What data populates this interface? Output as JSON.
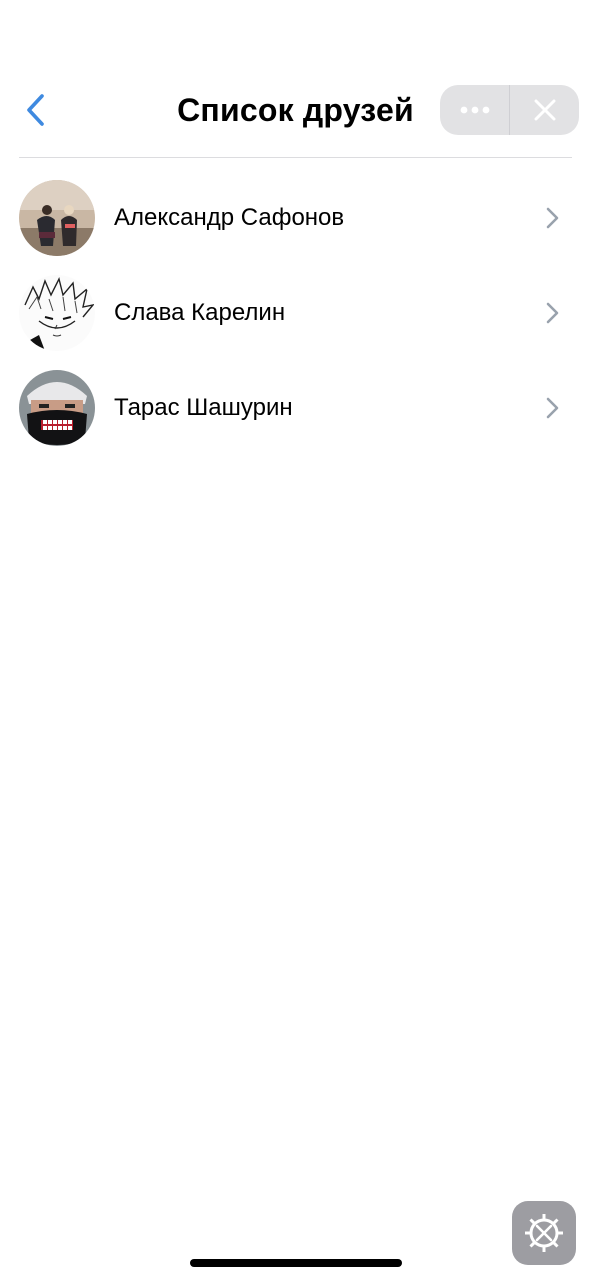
{
  "header": {
    "title": "Список друзей",
    "back_icon": "chevron-left-icon",
    "more_icon": "ellipsis-icon",
    "close_icon": "close-icon"
  },
  "friends": [
    {
      "name": "Александр Сафонов",
      "avatar": "photo-two-people"
    },
    {
      "name": "Слава Карелин",
      "avatar": "manga-character-sketch"
    },
    {
      "name": "Тарас Шашурин",
      "avatar": "person-in-mask"
    }
  ],
  "settings_button": {
    "icon": "gear-icon"
  },
  "colors": {
    "accent": "#3f8ae0",
    "chevron": "#99a2ad",
    "capsule": "#e2e2e4",
    "divider": "#dcdcdf",
    "fab": "#9d9da2"
  }
}
